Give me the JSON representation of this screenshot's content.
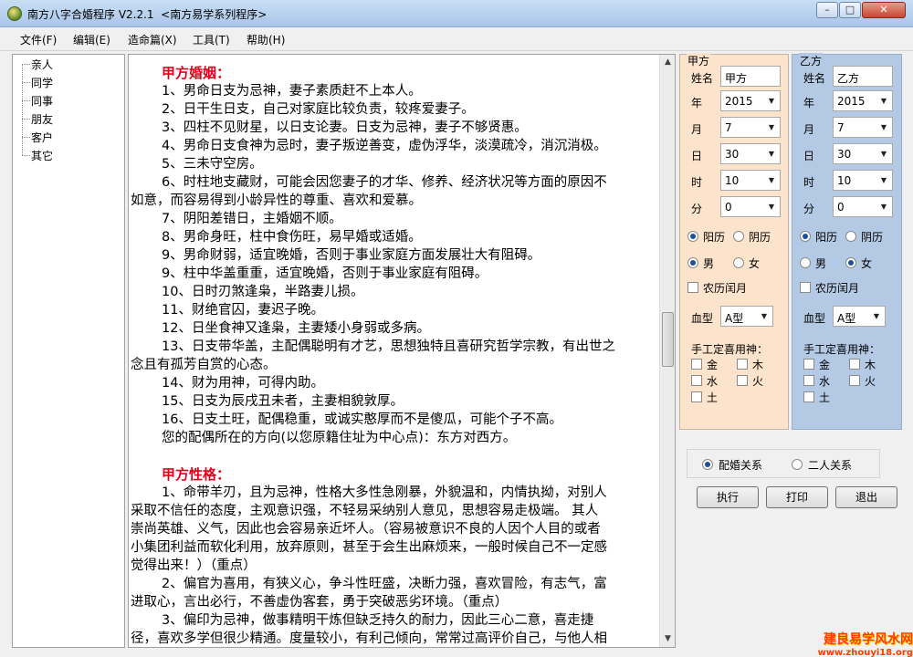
{
  "window": {
    "title": "南方八字合婚程序 V2.2.1  <南方易学系列程序>",
    "controls": {
      "minimize": "–",
      "maximize": "□",
      "close": "✕"
    }
  },
  "menu": [
    "文件(F)",
    "编辑(E)",
    "造命篇(X)",
    "工具(T)",
    "帮助(H)"
  ],
  "tree": [
    "亲人",
    "同学",
    "同事",
    "朋友",
    "客户",
    "其它"
  ],
  "content": {
    "marriage_title": "甲方婚姻：",
    "marriage_items": [
      "1、男命日支为忌神，妻子素质赶不上本人。",
      "2、日干生日支，自己对家庭比较负责，较疼爱妻子。",
      "3、四柱不见财星，以日支论妻。日支为忌神，妻子不够贤惠。",
      "4、男命日支食神为忌时，妻子叛逆善变，虚伪浮华，淡漠疏冷，消沉消极。",
      "5、三未守空房。",
      "6、时柱地支藏财，可能会因您妻子的才华、修养、经济状况等方面的原因不",
      "如意，而容易得到小龄异性的尊重、喜欢和爱慕。",
      "7、阴阳差错日，主婚姻不顺。",
      "8、男命身旺，柱中食伤旺，易早婚或适婚。",
      "9、男命财弱，适宜晚婚，否则于事业家庭方面发展壮大有阻碍。",
      "9、柱中华盖重重，适宜晚婚，否则于事业家庭有阻碍。",
      "10、日时刃煞逢枭，半路妻儿损。",
      "11、财绝官囚，妻迟子晚。",
      "12、日坐食神又逢枭，主妻矮小身弱或多病。",
      "13、日支带华盖，主配偶聪明有才艺，思想独特且喜研究哲学宗教，有出世之",
      "念且有孤芳自赏的心态。",
      "14、财为用神，可得内助。",
      "15、日支为辰戌丑未者，主妻相貌敦厚。",
      "16、日支土旺，配偶稳重，或诚实憨厚而不是傻瓜，可能个子不高。",
      "您的配偶所在的方向(以您原籍住址为中心点)：东方对西方。"
    ],
    "personality_title": "甲方性格：",
    "personality_items": [
      "1、命带羊刃，且为忌神，性格大多性急刚暴，外貌温和，内情执拗，对别人",
      "采取不信任的态度，主观意识强，不轻易采纳别人意见，思想容易走极端。 其人",
      "崇尚英雄、义气，因此也会容易亲近坏人。（容易被意识不良的人因个人目的或者",
      "小集团利益而软化利用，放弃原则，甚至于会生出麻烦来，一般时候自己不一定感",
      "觉得出来！）（重点）",
      "2、偏官为喜用，有狭义心，争斗性旺盛，决断力强，喜欢冒险，有志气，富",
      "进取心，言出必行，不善虚伪客套，勇于突破恶劣环境。（重点）",
      "3、偏印为忌神，做事精明干炼但缺乏持久的耐力，因此三心二意，喜走捷",
      "径，喜欢多学但很少精通。度量较小，有利己倾向，常常过高评价自己，与他人相"
    ]
  },
  "party_a": {
    "title": "甲方",
    "name_label": "姓名",
    "name_value": "甲方",
    "year_label": "年",
    "year_value": "2015",
    "month_label": "月",
    "month_value": "7",
    "day_label": "日",
    "day_value": "30",
    "hour_label": "时",
    "hour_value": "10",
    "minute_label": "分",
    "minute_value": "0",
    "solar_label": "阳历",
    "lunar_label": "阴历",
    "calendar_selected": "阳历",
    "male_label": "男",
    "female_label": "女",
    "gender_selected": "男",
    "leap_label": "农历闰月",
    "blood_label": "血型",
    "blood_value": "A型",
    "manual_label": "手工定喜用神：",
    "elements": [
      "金",
      "木",
      "水",
      "火",
      "土"
    ]
  },
  "party_b": {
    "title": "乙方",
    "name_label": "姓名",
    "name_value": "乙方",
    "year_label": "年",
    "year_value": "2015",
    "month_label": "月",
    "month_value": "7",
    "day_label": "日",
    "day_value": "30",
    "hour_label": "时",
    "hour_value": "10",
    "minute_label": "分",
    "minute_value": "0",
    "solar_label": "阳历",
    "lunar_label": "阴历",
    "calendar_selected": "阳历",
    "male_label": "男",
    "female_label": "女",
    "gender_selected": "女",
    "leap_label": "农历闰月",
    "blood_label": "血型",
    "blood_value": "A型",
    "manual_label": "手工定喜用神：",
    "elements": [
      "金",
      "木",
      "水",
      "火",
      "土"
    ]
  },
  "relation": {
    "marriage_label": "配婚关系",
    "pair_label": "二人关系",
    "selected": "配婚关系"
  },
  "buttons": {
    "run": "执行",
    "print": "打印",
    "exit": "退出"
  },
  "watermark": {
    "line1": "建良易学风水网",
    "line2": "www.zhouyi18.org"
  },
  "colors": {
    "section_title": "#e0001b",
    "party_a_bg": "#fce4cc",
    "party_b_bg": "#b3c9e4",
    "watermark": "#ff3b00"
  }
}
